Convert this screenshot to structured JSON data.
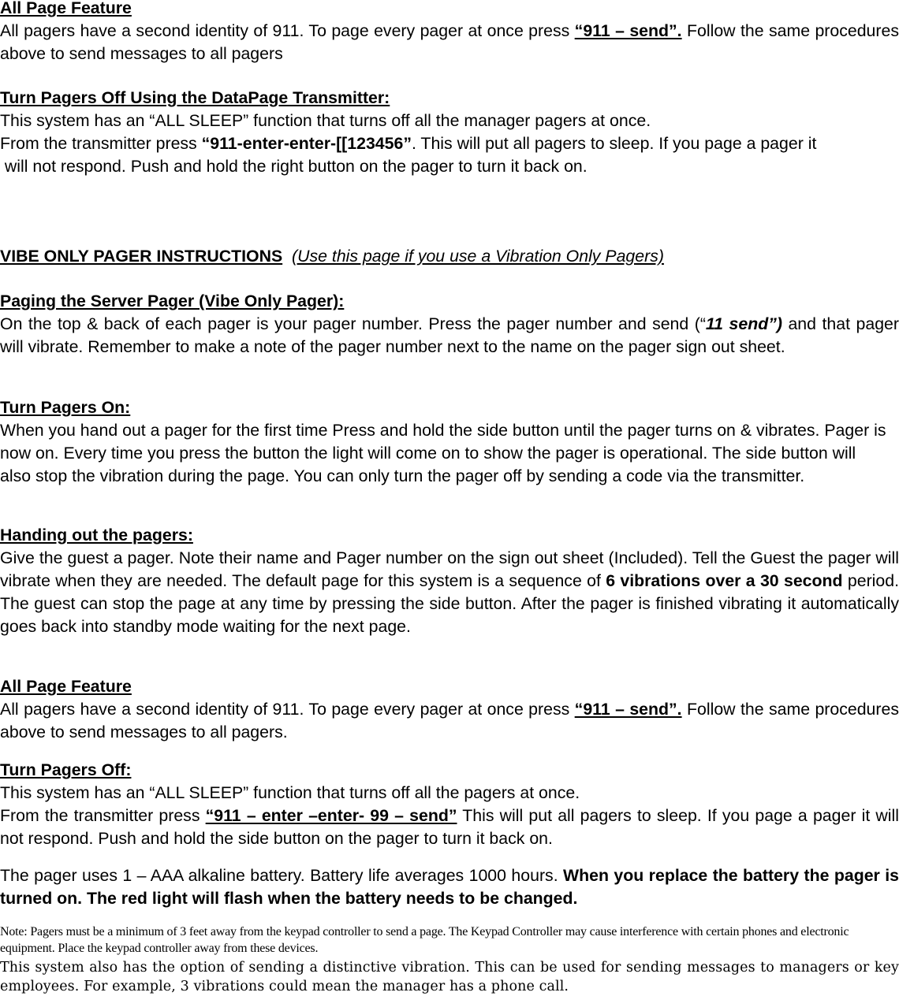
{
  "sections": {
    "all_page_1": {
      "heading": "All Page Feature",
      "text_before": "All pagers have a second identity of 911. To page every pager at once press ",
      "code": "“911 – send”.",
      "text_after": " Follow the same procedures above to send messages to all pagers"
    },
    "turn_off_transmitter": {
      "heading": "Turn Pagers Off Using the DataPage Transmitter:",
      "line1": "This system has an “ALL SLEEP” function that turns off all the manager pagers at once.",
      "line2_before": "From the transmitter press ",
      "line2_code": "“911-enter-enter-[[123456”",
      "line2_after": ". This will put all pagers to sleep. If you page a pager it",
      "line3": " will not respond. Push and hold the right button on the pager to turn it back on."
    },
    "vibe_title": {
      "title": "VIBE ONLY PAGER INSTRUCTIONS",
      "subtitle": "(Use this page if you use a Vibration Only Pagers)"
    },
    "paging_server": {
      "heading": "Paging the Server Pager (Vibe Only Pager):",
      "text_before": "On the top & back of each pager is your pager number. Press the pager number and send (“",
      "code": "11 send”)",
      "text_after": " and that pager will vibrate. Remember to make a note of the pager number next to the name on the pager sign out sheet."
    },
    "turn_on": {
      "heading": "Turn Pagers On:",
      "text": "When you hand out a pager for the first time Press and hold the side button until the pager turns on & vibrates. Pager is now on. Every time you press the button the light will come on to show the pager is operational. The side button will also stop the vibration during the page. You can only turn the pager off by sending a code via the transmitter."
    },
    "handing_out": {
      "heading": "Handing out the pagers:",
      "text_before": "Give the guest a pager. Note their name and Pager number on the sign out sheet (Included). Tell the Guest the pager will vibrate when they are needed. The default page for this system is a sequence of ",
      "bold": "6 vibrations over a 30 second",
      "text_after": " period. The guest can stop the page at any time by pressing the side button. After the pager is finished vibrating it automatically goes back into standby mode waiting for the next page."
    },
    "all_page_2": {
      "heading": "All Page Feature",
      "text_before": "All pagers have a second identity of 911. To page every pager at once press ",
      "code": "“911 – send”.",
      "text_after": " Follow the same procedures above to send messages to all pagers."
    },
    "turn_off": {
      "heading": "Turn Pagers Off:",
      "line1": "This system has an “ALL SLEEP” function that turns off all the pagers at once.",
      "text_before": "From the transmitter press ",
      "code": "“911 – enter –enter- 99 – send”",
      "text_after": " This will put all pagers to sleep. If you page a pager it will not respond. Push and hold the side button on the pager to turn it back on."
    },
    "battery": {
      "text_before": "The pager uses 1 – AAA alkaline battery. Battery life averages 1000 hours. ",
      "bold": "When you replace the battery the pager is turned on. The red light will flash when the battery needs to be changed."
    },
    "note": {
      "text": "Note: Pagers must be a minimum of 3 feet away from the keypad controller to send a page. The Keypad Controller may cause interference with certain phones and electronic equipment. Place the keypad controller away from these devices."
    },
    "distinctive": {
      "text": "This system also has the option of sending a distinctive vibration. This can be used for sending messages to managers or key employees. For example, 3 vibrations could mean the manager has a phone call."
    }
  }
}
